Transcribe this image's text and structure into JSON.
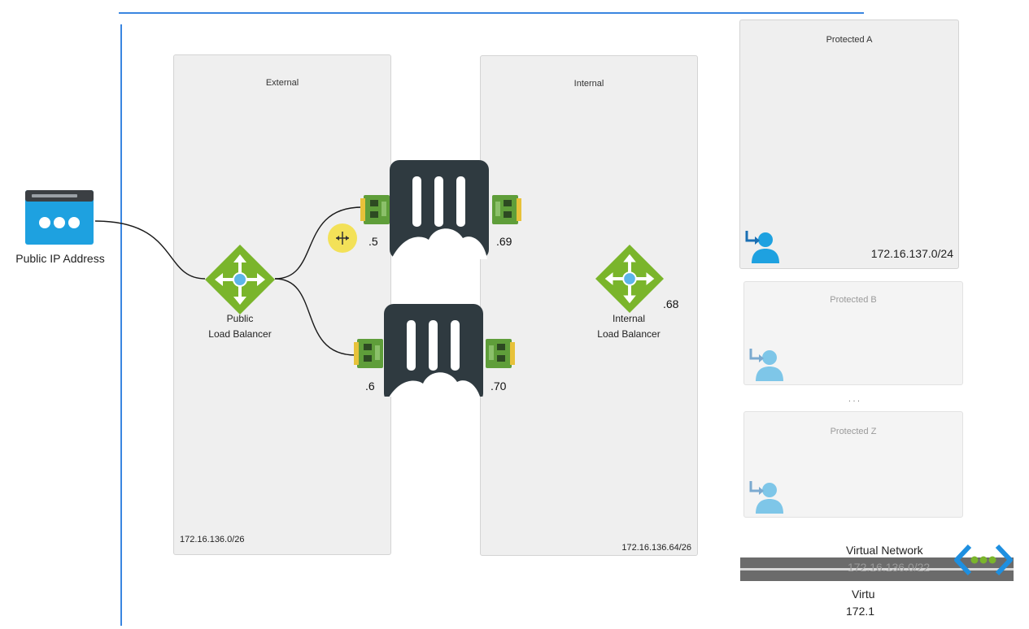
{
  "public_ip": {
    "label": "Public IP Address",
    "icon": "public-ip-icon"
  },
  "external": {
    "title": "External",
    "cidr": "172.16.136.0/26"
  },
  "internal": {
    "title": "Internal",
    "cidr": "172.16.136.64/26"
  },
  "public_lb": {
    "line1": "Public",
    "line2": "Load Balancer",
    "icon": "load-balancer-icon"
  },
  "internal_lb": {
    "line1": "Internal",
    "line2": "Load Balancer",
    "ip": ".68",
    "icon": "load-balancer-icon"
  },
  "fortigate_a": {
    "ext_ip": ".5",
    "int_ip": ".69",
    "icon": "fortigate-vm-icon"
  },
  "fortigate_b": {
    "ext_ip": ".6",
    "int_ip": ".70",
    "icon": "fortigate-vm-icon"
  },
  "protected": [
    {
      "title": "Protected A",
      "cidr": "172.16.137.0/24",
      "icon": "user-icon"
    },
    {
      "title": "Protected B",
      "icon": "user-icon"
    },
    {
      "title": "Protected Z",
      "icon": "user-icon"
    }
  ],
  "ellipsis": ". . .",
  "vnet": {
    "label": "Virtual Network",
    "cidr": "172.16.136.0/22",
    "icon": "vnet-icon"
  },
  "vnet_partial": {
    "label": "Virtu",
    "cidr": "172.1"
  },
  "colors": {
    "lb_green": "#7ab52b",
    "fortigate_dark": "#2f3a40",
    "azure_blue": "#1ea1e0",
    "border_blue": "#3a86e0"
  }
}
